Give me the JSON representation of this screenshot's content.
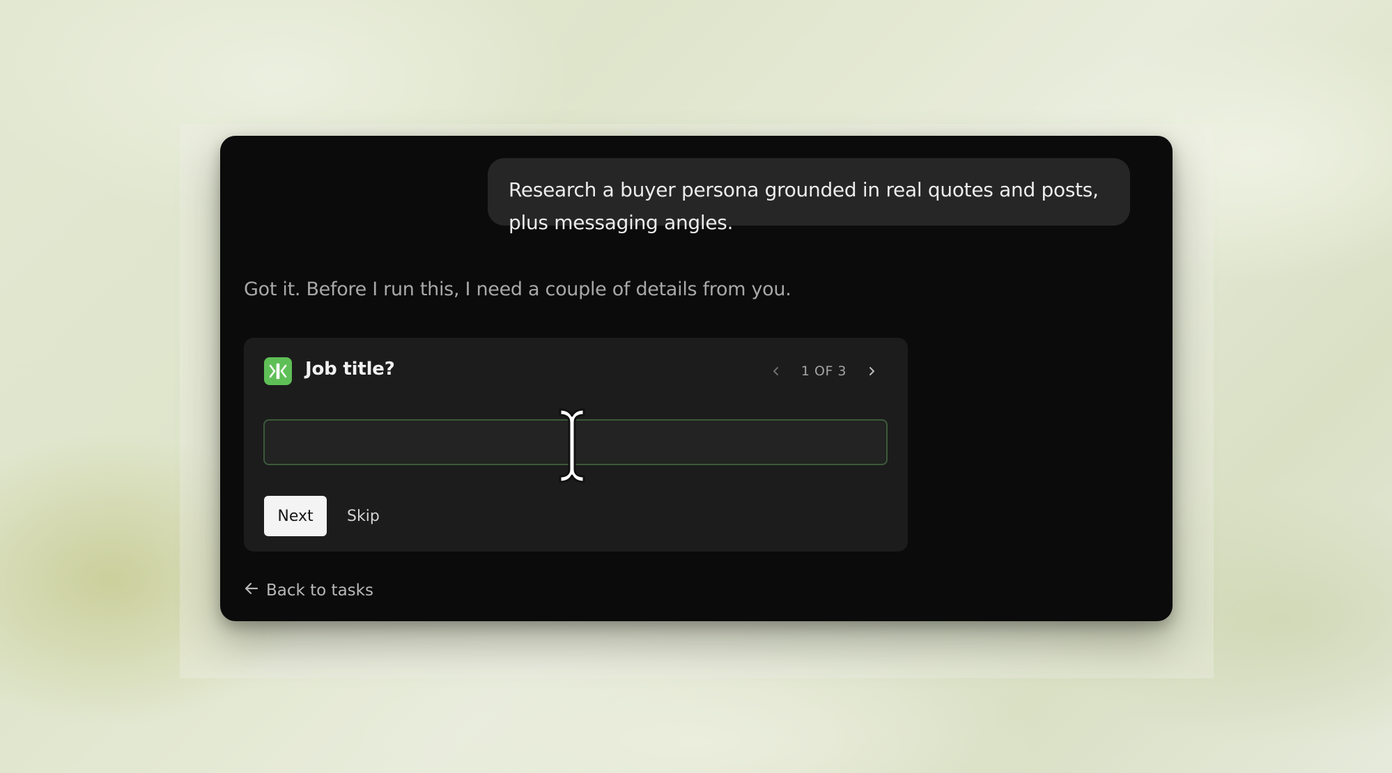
{
  "conversation": {
    "user_message": "Research a buyer persona grounded in real quotes and posts, plus messaging angles.",
    "assistant_message": "Got it. Before I run this, I need a couple of details from you."
  },
  "question_card": {
    "icon": "split-arrows-icon",
    "title": "Job title?",
    "pager": {
      "current": 1,
      "total": 3,
      "label": "1 OF 3",
      "prev_icon": "chevron-left-icon",
      "next_icon": "chevron-right-icon"
    },
    "input": {
      "value": "",
      "placeholder": ""
    },
    "next_label": "Next",
    "skip_label": "Skip"
  },
  "footer": {
    "back_label": "Back to tasks",
    "back_icon": "arrow-left-icon"
  },
  "cursor": "text-cursor-icon",
  "colors": {
    "window_bg": "#0b0b0b",
    "bubble_bg": "#262626",
    "card_bg": "#1c1c1c",
    "accent_green": "#5fbf57",
    "input_border": "#3c5a3a"
  }
}
